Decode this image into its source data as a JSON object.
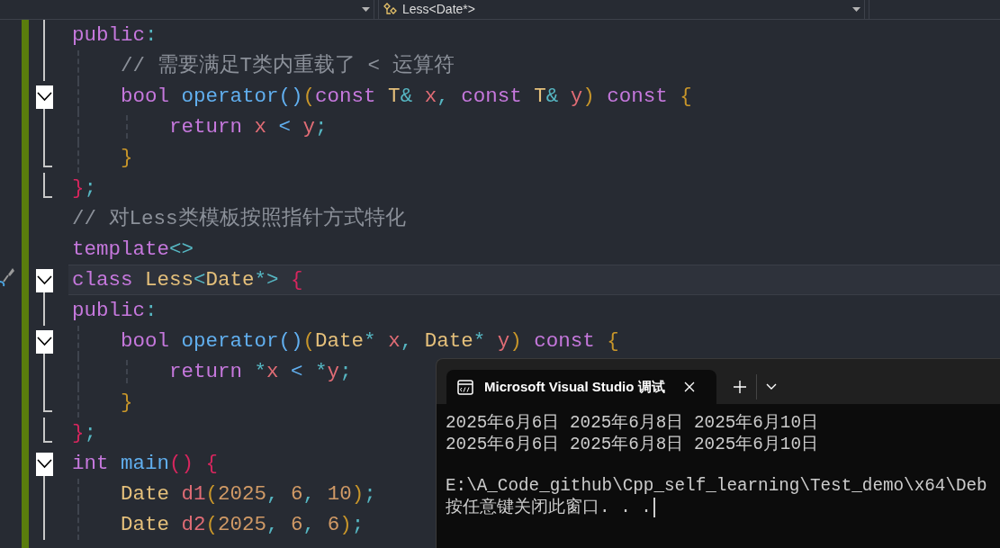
{
  "toolbar": {
    "navigation_dropdown": {
      "label": "Less<Date*>"
    }
  },
  "editor": {
    "lines": [
      {
        "kind": "inner",
        "current": false,
        "tokens": [
          {
            "text": "public",
            "kind": "keyword"
          },
          {
            "text": ":",
            "kind": "operator"
          }
        ]
      },
      {
        "kind": "inner",
        "current": false,
        "tokens": [
          {
            "text": "    // 需要满足T类内重载了 < 运算符",
            "kind": "comment"
          }
        ]
      },
      {
        "kind": "start",
        "current": false,
        "tokens": [
          {
            "text": "    bool ",
            "kind": "keyword"
          },
          {
            "text": "operator",
            "kind": "function"
          },
          {
            "text": "()",
            "kind": "bracket_blue"
          },
          {
            "text": "(",
            "kind": "bracket_gold"
          },
          {
            "text": "const ",
            "kind": "keyword"
          },
          {
            "text": "T",
            "kind": "type"
          },
          {
            "text": "& ",
            "kind": "operator"
          },
          {
            "text": "x",
            "kind": "variable"
          },
          {
            "text": ", ",
            "kind": "operator"
          },
          {
            "text": "const ",
            "kind": "keyword"
          },
          {
            "text": "T",
            "kind": "type"
          },
          {
            "text": "& ",
            "kind": "operator"
          },
          {
            "text": "y",
            "kind": "variable"
          },
          {
            "text": ") ",
            "kind": "bracket_gold"
          },
          {
            "text": "const ",
            "kind": "keyword"
          },
          {
            "text": "{",
            "kind": "bracket_gold"
          }
        ]
      },
      {
        "kind": "inner",
        "current": false,
        "tokens": [
          {
            "text": "        return ",
            "kind": "keyword"
          },
          {
            "text": "x",
            "kind": "variable"
          },
          {
            "text": " < ",
            "kind": "bracket_blue"
          },
          {
            "text": "y",
            "kind": "variable"
          },
          {
            "text": ";",
            "kind": "operator"
          }
        ]
      },
      {
        "kind": "end",
        "current": false,
        "tokens": [
          {
            "text": "    }",
            "kind": "bracket_gold"
          }
        ]
      },
      {
        "kind": "end",
        "current": false,
        "tokens": [
          {
            "text": "}",
            "kind": "bracket_red"
          },
          {
            "text": ";",
            "kind": "operator"
          }
        ]
      },
      {
        "kind": "none",
        "current": false,
        "tokens": [
          {
            "text": "// 对Less类模板按照指针方式特化",
            "kind": "comment"
          }
        ]
      },
      {
        "kind": "none",
        "current": false,
        "tokens": [
          {
            "text": "template",
            "kind": "keyword"
          },
          {
            "text": "<>",
            "kind": "operator"
          }
        ]
      },
      {
        "kind": "start",
        "current": true,
        "tokens": [
          {
            "text": "class ",
            "kind": "keyword"
          },
          {
            "text": "Less",
            "kind": "type"
          },
          {
            "text": "<",
            "kind": "operator"
          },
          {
            "text": "Date",
            "kind": "type"
          },
          {
            "text": "*> ",
            "kind": "operator"
          },
          {
            "text": "{",
            "kind": "bracket_red"
          }
        ]
      },
      {
        "kind": "inner",
        "current": false,
        "tokens": [
          {
            "text": "public",
            "kind": "keyword"
          },
          {
            "text": ":",
            "kind": "operator"
          }
        ]
      },
      {
        "kind": "start",
        "current": false,
        "tokens": [
          {
            "text": "    bool ",
            "kind": "keyword"
          },
          {
            "text": "operator",
            "kind": "function"
          },
          {
            "text": "()",
            "kind": "bracket_blue"
          },
          {
            "text": "(",
            "kind": "bracket_gold"
          },
          {
            "text": "Date",
            "kind": "type"
          },
          {
            "text": "* ",
            "kind": "operator"
          },
          {
            "text": "x",
            "kind": "variable"
          },
          {
            "text": ", ",
            "kind": "operator"
          },
          {
            "text": "Date",
            "kind": "type"
          },
          {
            "text": "* ",
            "kind": "operator"
          },
          {
            "text": "y",
            "kind": "variable"
          },
          {
            "text": ") ",
            "kind": "bracket_gold"
          },
          {
            "text": "const ",
            "kind": "keyword"
          },
          {
            "text": "{",
            "kind": "bracket_gold"
          }
        ]
      },
      {
        "kind": "inner",
        "current": false,
        "tokens": [
          {
            "text": "        return ",
            "kind": "keyword"
          },
          {
            "text": "*",
            "kind": "operator"
          },
          {
            "text": "x",
            "kind": "variable"
          },
          {
            "text": " < ",
            "kind": "bracket_blue"
          },
          {
            "text": "*",
            "kind": "operator"
          },
          {
            "text": "y",
            "kind": "variable"
          },
          {
            "text": ";",
            "kind": "operator"
          }
        ]
      },
      {
        "kind": "end",
        "current": false,
        "tokens": [
          {
            "text": "    }",
            "kind": "bracket_gold"
          }
        ]
      },
      {
        "kind": "end",
        "current": false,
        "tokens": [
          {
            "text": "}",
            "kind": "bracket_red"
          },
          {
            "text": ";",
            "kind": "operator"
          }
        ]
      },
      {
        "kind": "start",
        "current": false,
        "tokens": [
          {
            "text": "int ",
            "kind": "keyword"
          },
          {
            "text": "main",
            "kind": "function"
          },
          {
            "text": "() {",
            "kind": "bracket_red"
          }
        ]
      },
      {
        "kind": "inner",
        "current": false,
        "tokens": [
          {
            "text": "    Date ",
            "kind": "type"
          },
          {
            "text": "d1",
            "kind": "variable"
          },
          {
            "text": "(",
            "kind": "bracket_gold"
          },
          {
            "text": "2025",
            "kind": "number"
          },
          {
            "text": ", ",
            "kind": "operator"
          },
          {
            "text": "6",
            "kind": "number"
          },
          {
            "text": ", ",
            "kind": "operator"
          },
          {
            "text": "10",
            "kind": "number"
          },
          {
            "text": ")",
            "kind": "bracket_gold"
          },
          {
            "text": ";",
            "kind": "operator"
          }
        ]
      },
      {
        "kind": "inner",
        "current": false,
        "tokens": [
          {
            "text": "    Date ",
            "kind": "type"
          },
          {
            "text": "d2",
            "kind": "variable"
          },
          {
            "text": "(",
            "kind": "bracket_gold"
          },
          {
            "text": "2025",
            "kind": "number"
          },
          {
            "text": ", ",
            "kind": "operator"
          },
          {
            "text": "6",
            "kind": "number"
          },
          {
            "text": ", ",
            "kind": "operator"
          },
          {
            "text": "6",
            "kind": "number"
          },
          {
            "text": ")",
            "kind": "bracket_gold"
          },
          {
            "text": ";",
            "kind": "operator"
          }
        ]
      }
    ]
  },
  "console": {
    "tab": {
      "title": "Microsoft Visual Studio 调试"
    },
    "output_blocks": [
      [
        "2025年6月6日 2025年6月8日 2025年6月10日",
        "2025年6月6日 2025年6月8日 2025年6月10日"
      ],
      [
        "E:\\A_Code_github\\Cpp_self_learning\\Test_demo\\x64\\Deb",
        "按任意键关闭此窗口. . ."
      ]
    ]
  }
}
